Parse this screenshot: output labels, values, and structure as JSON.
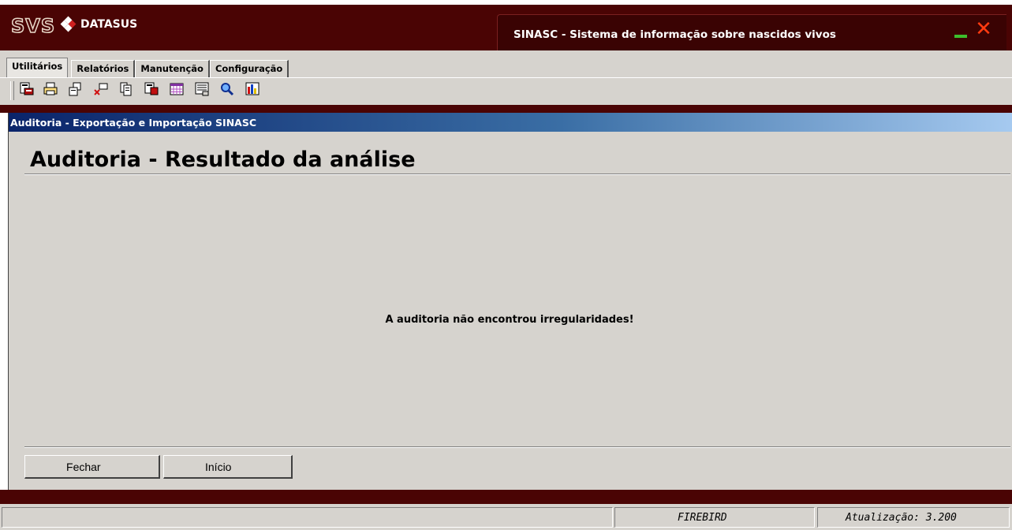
{
  "window": {
    "logo_svs": "SVS",
    "logo_datasus": "DATASUS",
    "app_title": "SINASC - Sistema de informação sobre nascidos vivos",
    "colors": {
      "titlebar": "#4a0404",
      "minimize": "#3dbe2c",
      "close": "#ff3b10"
    }
  },
  "menu": {
    "tabs": [
      {
        "label": "Utilitários"
      },
      {
        "label": "Relatórios"
      },
      {
        "label": "Manutenção"
      },
      {
        "label": "Configuração"
      }
    ],
    "active_tab": "Utilitários"
  },
  "toolbar": {
    "icons": [
      "export-icon",
      "print-icon",
      "copy-icon",
      "delete-icon",
      "documents-icon",
      "import-icon",
      "calendar-icon",
      "list-icon",
      "search-icon",
      "chart-icon"
    ]
  },
  "panel": {
    "header": "Auditoria - Exportação e Importação SINASC",
    "title": "Auditoria - Resultado da análise",
    "message": "A auditoria não encontrou irregularidades!",
    "buttons": {
      "close_accel": "F",
      "close_rest": "echar",
      "start_accel": "I",
      "start_rest": "nício"
    }
  },
  "status": {
    "database": "FIREBIRD",
    "version": "Atualização: 3.200"
  }
}
